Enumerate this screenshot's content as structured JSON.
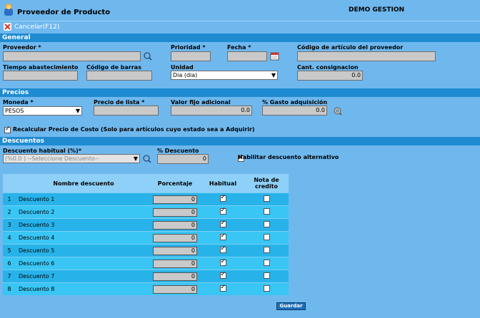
{
  "window": {
    "title": "Proveedor de Producto",
    "company": "DEMO GESTION"
  },
  "toolbar": {
    "cancel_label": "Cancelar(F12)"
  },
  "general": {
    "header": "General",
    "proveedor_label": "Proveedor *",
    "proveedor_value": "",
    "prioridad_label": "Prioridad *",
    "prioridad_value": "",
    "fecha_label": "Fecha *",
    "fecha_value": "",
    "codigo_art_label": "Código de artículo del proveedor",
    "codigo_art_value": "",
    "tiempo_label": "Tiempo abastecimiento",
    "tiempo_value": "",
    "barras_label": "Código de barras",
    "barras_value": "",
    "unidad_label": "Unidad",
    "unidad_value": "Dia (dia)",
    "consig_label": "Cant. consignacion",
    "consig_value": "0.0"
  },
  "precios": {
    "header": "Precios",
    "moneda_label": "Moneda *",
    "moneda_value": "PESOS",
    "lista_label": "Precio de lista *",
    "lista_value": "",
    "valor_label": "Valor fijo adicional",
    "valor_value": "0.0",
    "gasto_label": "% Gasto adquisición",
    "gasto_value": "0.0",
    "recalc_label": "Recalcular Precio de Costo (Solo para artículos cuyo estado sea a Adquirir)",
    "recalc_checked": true
  },
  "descuentos": {
    "header": "Descuentos",
    "habitual_label": "Descuento habitual (%)*",
    "habitual_placeholder": "(%0.0 ) --Seleccione Descuento--",
    "pct_label": "% Descuento",
    "pct_value": "0",
    "alt_label": "Habilitar descuento alternativo",
    "alt_checked": true,
    "table": {
      "headers": {
        "nombre": "Nombre descuento",
        "porcentaje": "Porcentaje",
        "habitual": "Habitual",
        "nota": "Nota de credito"
      },
      "rows": [
        {
          "num": "1",
          "name": "Descuento 1",
          "pct": "0",
          "habitual": true,
          "nota": false
        },
        {
          "num": "2",
          "name": "Descuento 2",
          "pct": "0",
          "habitual": true,
          "nota": false
        },
        {
          "num": "3",
          "name": "Descuento 3",
          "pct": "0",
          "habitual": true,
          "nota": false
        },
        {
          "num": "4",
          "name": "Descuento 4",
          "pct": "0",
          "habitual": true,
          "nota": false
        },
        {
          "num": "5",
          "name": "Descuento 5",
          "pct": "0",
          "habitual": true,
          "nota": false
        },
        {
          "num": "6",
          "name": "Descuento 6",
          "pct": "0",
          "habitual": true,
          "nota": false
        },
        {
          "num": "7",
          "name": "Descuento 7",
          "pct": "0",
          "habitual": true,
          "nota": false
        },
        {
          "num": "8",
          "name": "Descuento 8",
          "pct": "0",
          "habitual": true,
          "nota": false
        }
      ]
    }
  },
  "actions": {
    "save_label": "Guardar"
  },
  "colors": {
    "background": "#6fb8ee",
    "section_header": "#1f8bd1",
    "table_row": "#27b3ea",
    "table_header": "#8ed0f8"
  },
  "icons": [
    "app-icon",
    "cancel-icon",
    "search-icon",
    "calendar-icon",
    "wrench-icon"
  ]
}
